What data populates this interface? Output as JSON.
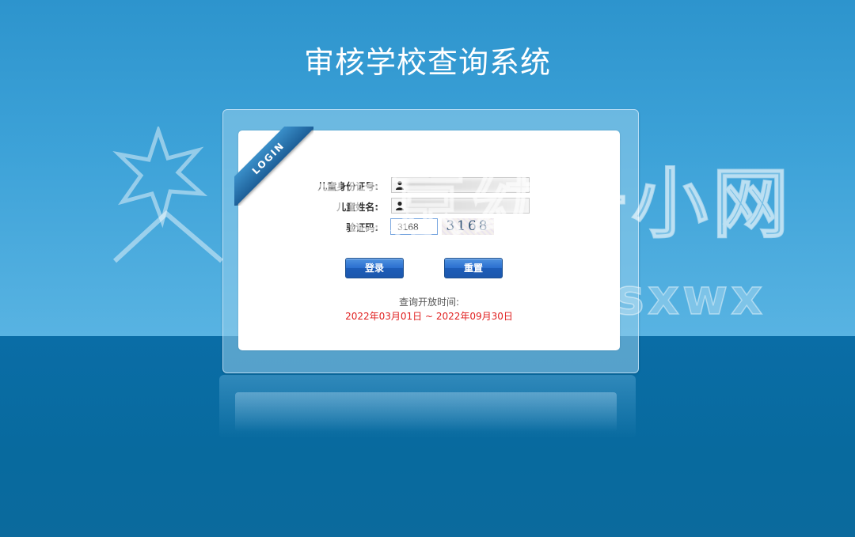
{
  "header": {
    "title": "审核学校查询系统"
  },
  "ribbon": {
    "text": "LOGIN"
  },
  "watermark": {
    "line1": "北京幼升小网",
    "line2": "微信号：bjysxwx"
  },
  "form": {
    "id_label": "儿童身份证号:",
    "name_label": "儿童姓名:",
    "captcha_label": "验证码:",
    "captcha_value": "3168",
    "captcha_image_text": "3168"
  },
  "buttons": {
    "login": "登录",
    "reset": "重置"
  },
  "schedule": {
    "label": "查询开放时间:",
    "range": "2022年03月01日 ~ 2022年09月30日"
  },
  "icons": {
    "user": "user-icon"
  },
  "colors": {
    "accent": "#2d94cd",
    "range_text": "#e02020",
    "button": "#2a6fcf"
  }
}
